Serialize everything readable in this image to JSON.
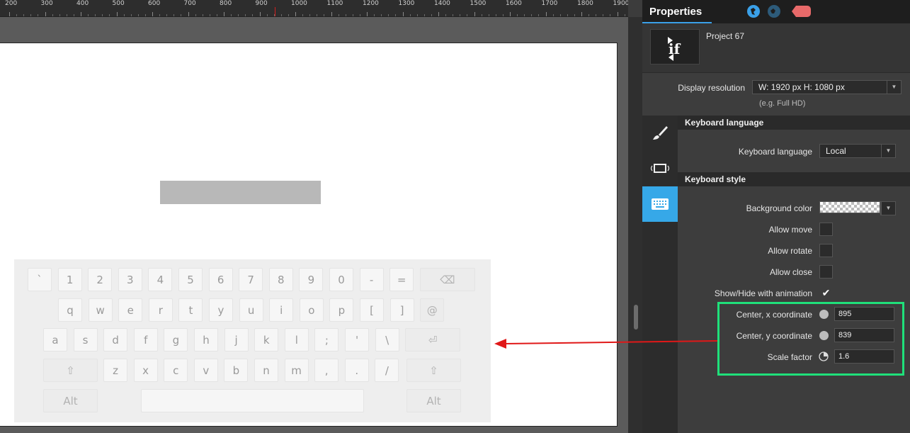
{
  "ruler": {
    "labels": [
      "200",
      "300",
      "400",
      "500",
      "600",
      "700",
      "800",
      "900",
      "1000",
      "1100",
      "1200",
      "1300",
      "1400",
      "1500",
      "1600",
      "1700",
      "1800",
      "1900"
    ]
  },
  "keyboard": {
    "rows": [
      [
        "`",
        "1",
        "2",
        "3",
        "4",
        "5",
        "6",
        "7",
        "8",
        "9",
        "0",
        "-",
        "=",
        "⌫"
      ],
      [
        "q",
        "w",
        "e",
        "r",
        "t",
        "y",
        "u",
        "i",
        "o",
        "p",
        "[",
        "]",
        "@"
      ],
      [
        "a",
        "s",
        "d",
        "f",
        "g",
        "h",
        "j",
        "k",
        "l",
        ";",
        "'",
        "\\",
        "⏎"
      ],
      [
        "⇧",
        "z",
        "x",
        "c",
        "v",
        "b",
        "n",
        "m",
        ",",
        ".",
        "/",
        "⇧"
      ],
      [
        "Alt",
        "",
        "Alt"
      ]
    ]
  },
  "panel": {
    "title": "Properties",
    "project_name": "Project 67",
    "thumb_text": "if",
    "display_resolution_label": "Display resolution",
    "display_resolution_value": "W:  1920 px    H:  1080 px",
    "display_resolution_hint": "(e.g. Full HD)",
    "keyboard_language_header": "Keyboard language",
    "keyboard_language_label": "Keyboard language",
    "keyboard_language_value": "Local",
    "keyboard_style_header": "Keyboard style",
    "background_color_label": "Background color",
    "allow_move_label": "Allow move",
    "allow_rotate_label": "Allow rotate",
    "allow_close_label": "Allow close",
    "show_hide_label": "Show/Hide with animation",
    "show_hide_checked": "✔",
    "center_x_label": "Center, x coordinate",
    "center_x_value": "895",
    "center_y_label": "Center, y coordinate",
    "center_y_value": "839",
    "scale_label": "Scale factor",
    "scale_value": "1.6"
  },
  "colors": {
    "accent": "#36a8e8",
    "highlight": "#1fe07a",
    "arrow": "#e01818"
  }
}
